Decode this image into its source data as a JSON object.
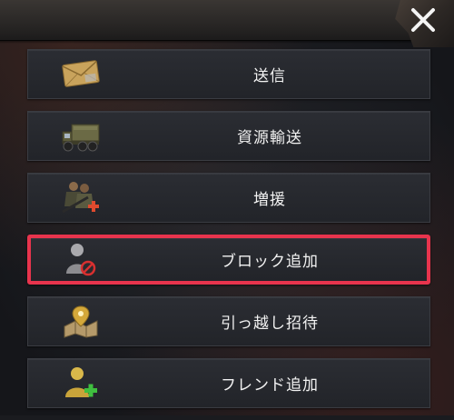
{
  "dialog": {
    "close_icon": "close-icon"
  },
  "menu": {
    "items": [
      {
        "label": "送信",
        "icon": "envelope-icon"
      },
      {
        "label": "資源輸送",
        "icon": "truck-icon"
      },
      {
        "label": "増援",
        "icon": "reinforce-soldiers-icon"
      },
      {
        "label": "ブロック追加",
        "icon": "block-user-icon",
        "highlighted": true
      },
      {
        "label": "引っ越し招待",
        "icon": "map-pin-icon"
      },
      {
        "label": "フレンド追加",
        "icon": "add-friend-icon"
      }
    ]
  },
  "colors": {
    "highlight_border": "#e8344d",
    "text": "#f2f2f2",
    "plus_red": "#e04a2e",
    "plus_green": "#3fbf3f",
    "gold": "#d4a83a"
  }
}
